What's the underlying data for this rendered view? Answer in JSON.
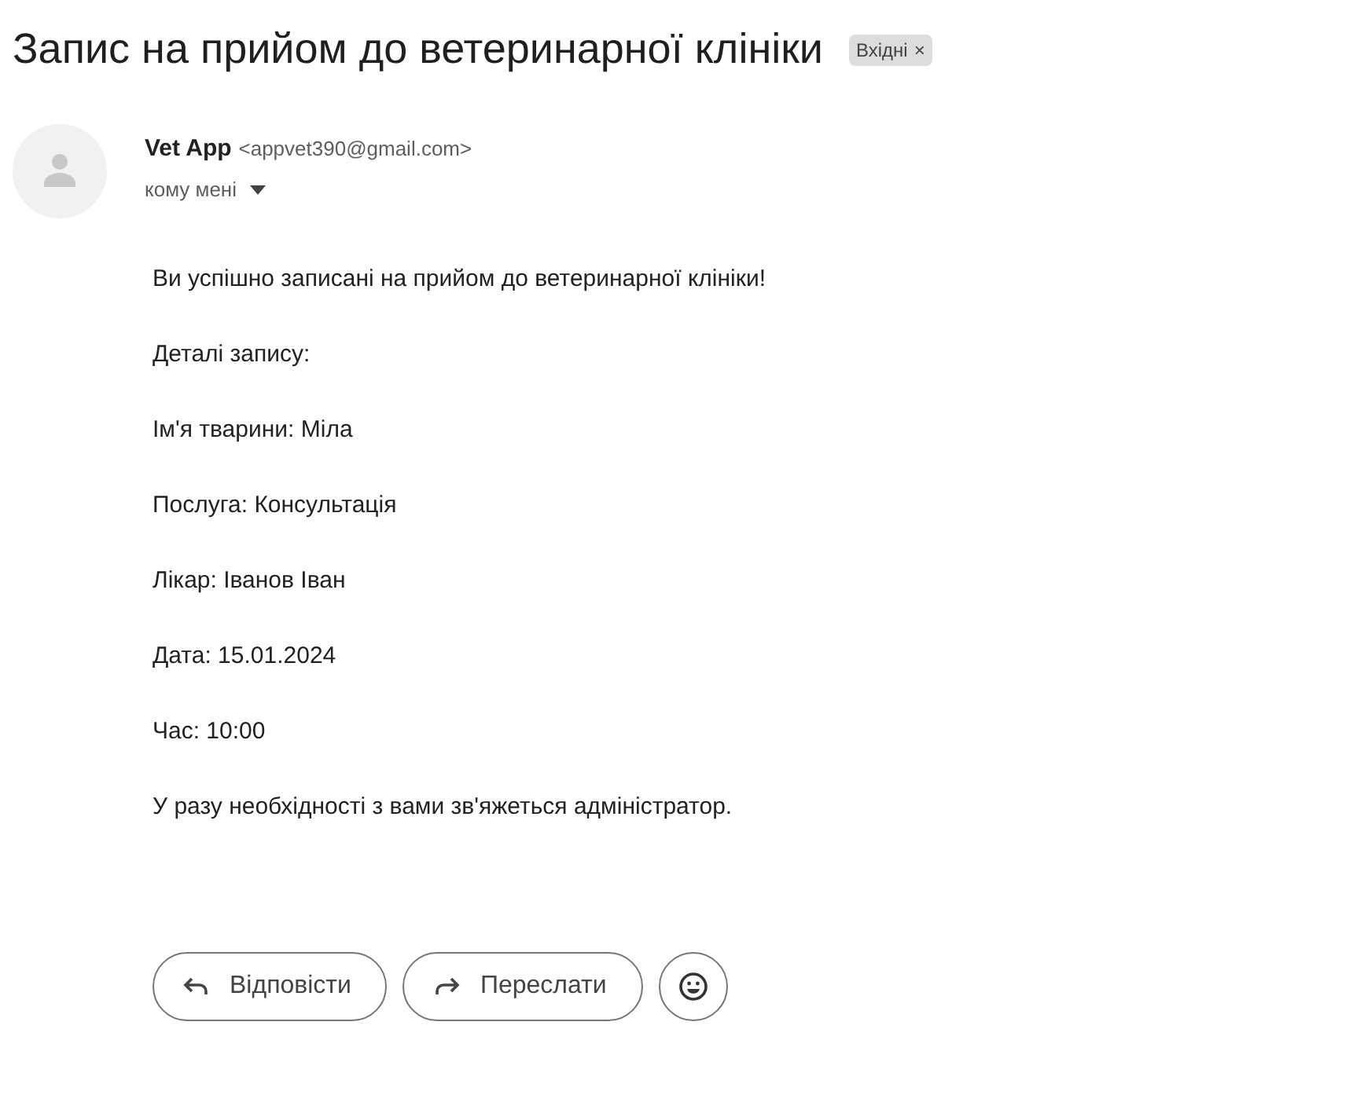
{
  "subject": "Запис на прийом до ветеринарної клініки",
  "labels": [
    {
      "text": "Вхідні",
      "close": "×"
    }
  ],
  "sender": {
    "name": "Vet App",
    "email": "<appvet390@gmail.com>",
    "recipient": "кому мені"
  },
  "body": [
    "Ви успішно записані на прийом до ветеринарної клініки!",
    "Деталі запису:",
    "Ім'я тварини: Міла",
    "Послуга: Консультація",
    "Лікар: Іванов Іван",
    "Дата: 15.01.2024",
    "Час: 10:00",
    "У разу необхідності з вами зв'яжеться адміністратор."
  ],
  "actions": [
    {
      "kind": "reply",
      "label": "Відповісти"
    },
    {
      "kind": "forward",
      "label": "Переслати"
    },
    {
      "kind": "emoji"
    }
  ]
}
